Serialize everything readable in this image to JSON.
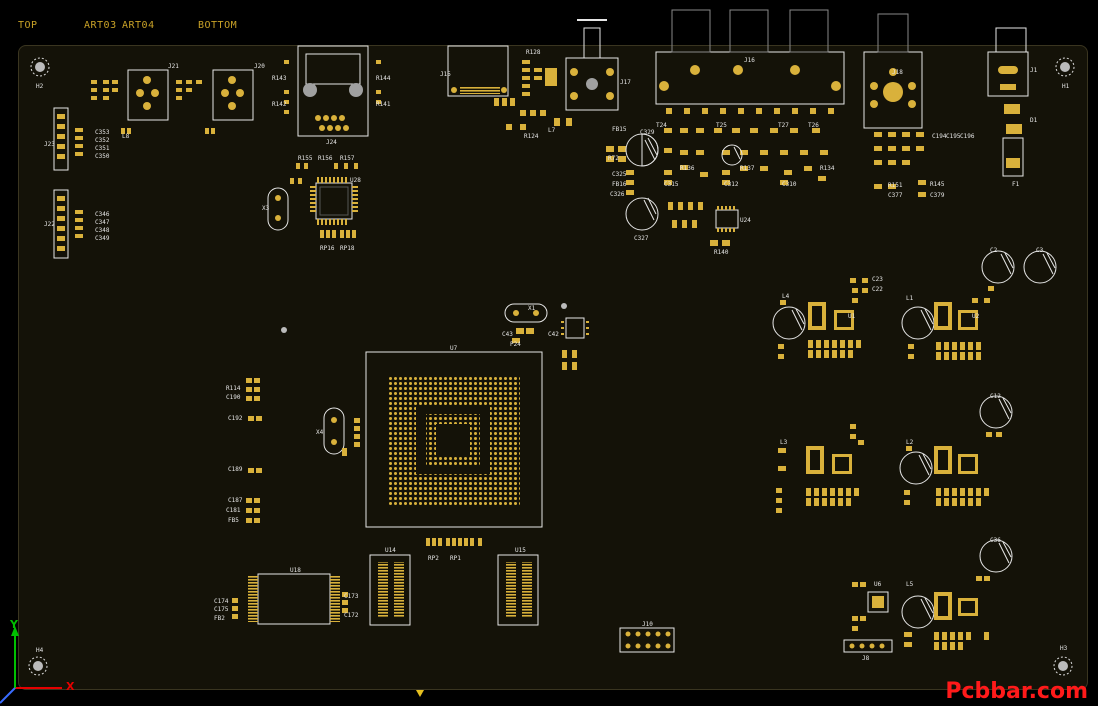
{
  "layer_tabs": {
    "top": "TOP",
    "art03": "ART03",
    "art04": "ART04",
    "bottom": "BOTTOM"
  },
  "watermark": "Pcbbar.com",
  "axes": {
    "y": "Y",
    "x": "X"
  },
  "colors": {
    "board": "#141208",
    "silk": "#e6e6e6",
    "pad": "#d9b13b",
    "hole": "#a0a0a0",
    "accent": "#c9a227",
    "watermark": "#ff1a1a"
  },
  "labels": {
    "u7": "U7",
    "u14": "U14",
    "u15": "U15",
    "u18": "U18",
    "u28": "U28",
    "u24": "U24",
    "u3": "U3",
    "x1": "X1",
    "x3": "X3",
    "x4": "X4",
    "j1": "J1",
    "j2": "J2",
    "j8": "J8",
    "j10": "J10",
    "j15": "J15",
    "j16": "J16",
    "j17": "J17",
    "j18": "J18",
    "j20": "J20",
    "j21": "J21",
    "j22": "J22",
    "j23": "J23",
    "j24": "J24",
    "f1": "F1",
    "d1": "D1",
    "h1": "H1",
    "h2": "H2",
    "h3": "H3",
    "h4": "H4",
    "rp1": "RP1",
    "rp2": "RP2",
    "rp16": "RP16",
    "rp18": "RP18",
    "l1": "L1",
    "l2": "L2",
    "l3": "L3",
    "l4": "L4",
    "l5": "L5",
    "l7": "L7",
    "l8": "L8",
    "c2": "C2",
    "c3": "C3",
    "c12": "C12",
    "c36": "C36",
    "c327": "C327",
    "c329": "C329",
    "c190": "C190",
    "c189": "C189",
    "c187": "C187",
    "c181": "C181",
    "c353": "C353",
    "c352": "C352",
    "c351": "C351",
    "c350": "C350",
    "c346": "C346",
    "c347": "C347",
    "c348": "C348",
    "c349": "C349",
    "c174": "C174",
    "c175": "C175",
    "fb2": "FB2",
    "c42": "C42",
    "c43": "C43",
    "p24": "P24",
    "r140": "R140",
    "r128": "R128",
    "r124": "R124",
    "c173": "C173",
    "c172": "C172",
    "r114": "R114",
    "fb5": "FB5",
    "c192": "C192",
    "u1": "U1",
    "u2": "U2",
    "u6": "U6",
    "c23": "C23",
    "c22": "C22",
    "fb15": "FB15",
    "fb16": "FB16",
    "c326": "C326",
    "c325": "C325",
    "r136": "R136",
    "r137": "R137",
    "r134": "R134",
    "c315": "C315",
    "c312": "C312",
    "c310": "C310",
    "r151": "R151",
    "r145": "R145",
    "c377": "C377",
    "c379": "C379",
    "c194": "C194",
    "c195": "C195",
    "c196": "C196",
    "r141": "R141",
    "r144": "R144",
    "r142": "R142",
    "r143": "R143",
    "r155": "R155",
    "r156": "R156",
    "r157": "R157",
    "t24": "T24",
    "t25": "T25",
    "t27": "T27",
    "t26": "T26",
    "r72": "R72"
  }
}
